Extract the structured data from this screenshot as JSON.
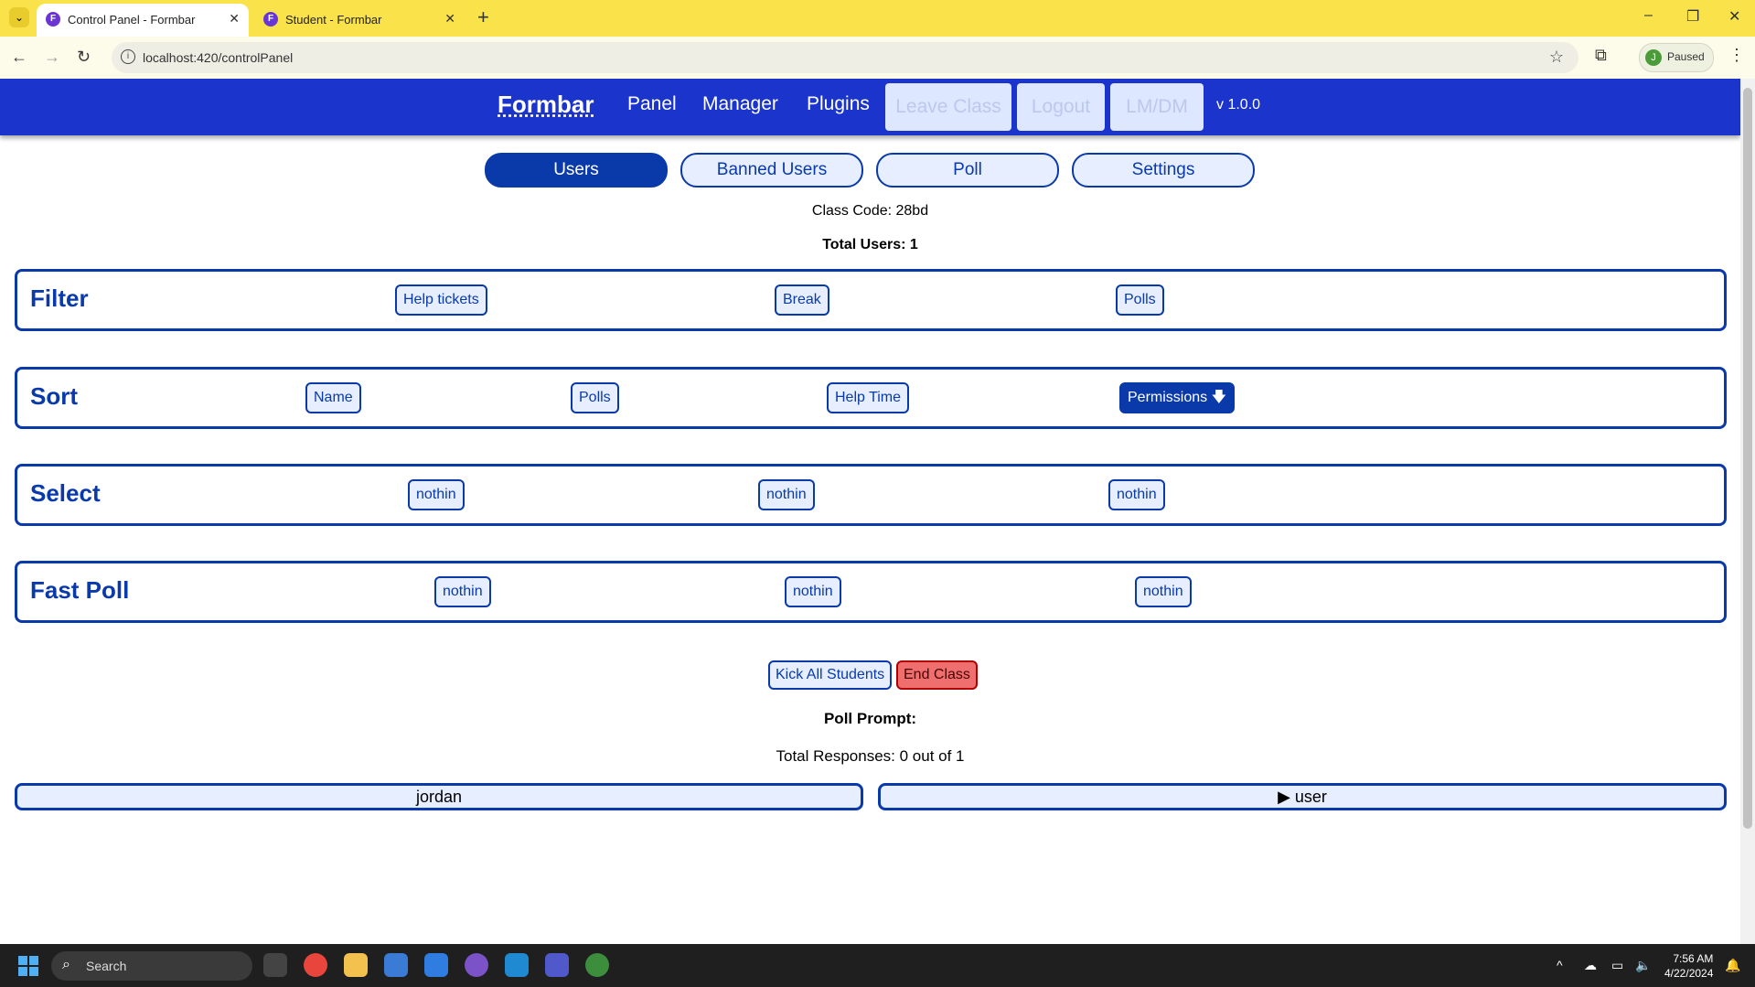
{
  "browser": {
    "tabs": [
      {
        "title": "Control Panel - Formbar",
        "favicon": "F",
        "close": "✕"
      },
      {
        "title": "Student - Formbar",
        "favicon": "F",
        "close": "✕"
      }
    ],
    "new_tab": "+",
    "url": "localhost:420/controlPanel",
    "profile_initial": "J",
    "profile_status": "Paused",
    "window_controls": [
      "–",
      "❐",
      "✕"
    ]
  },
  "navbar": {
    "brand": "Formbar",
    "links": [
      "Panel",
      "Manager",
      "Plugins"
    ],
    "disabled_buttons": [
      "Leave Class",
      "Logout",
      "LM/DM"
    ],
    "version": "v 1.0.0"
  },
  "tabs": [
    "Users",
    "Banned Users",
    "Poll",
    "Settings"
  ],
  "class_info": {
    "class_code": "Class Code: 28bd",
    "total_users": "Total Users: 1"
  },
  "panels": {
    "filter": {
      "title": "Filter",
      "buttons": [
        "Help tickets",
        "Break",
        "Polls"
      ]
    },
    "sort": {
      "title": "Sort",
      "buttons": [
        "Name",
        "Polls",
        "Help Time",
        "Permissions 🡇"
      ]
    },
    "select": {
      "title": "Select",
      "buttons": [
        "nothin",
        "nothin",
        "nothin"
      ]
    },
    "fast_poll": {
      "title": "Fast Poll",
      "buttons": [
        "nothin",
        "nothin",
        "nothin"
      ]
    }
  },
  "actions": {
    "kick_all": "Kick All Students",
    "end_class": "End Class"
  },
  "poll": {
    "prompt": "Poll Prompt:",
    "responses": "Total Responses: 0 out of 1"
  },
  "users": [
    "jordan",
    "▶ user"
  ],
  "taskbar": {
    "search_placeholder": "Search",
    "time": "7:56 AM",
    "date": "4/22/2024"
  },
  "colors": {
    "navbar": "#1a34cc",
    "accent": "#0a3aaa",
    "danger": "#ef6f6f",
    "tabstrip": "#f9e24a"
  }
}
